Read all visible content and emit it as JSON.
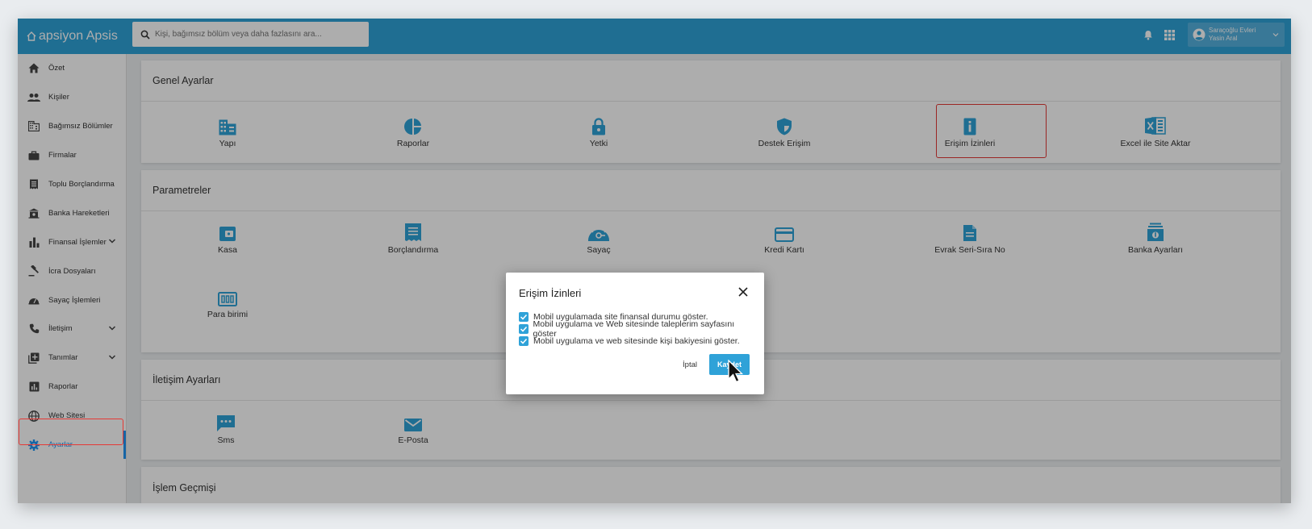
{
  "app": {
    "logo": "apsiyon Apsis"
  },
  "search": {
    "placeholder": "Kişi, bağımsız bölüm veya daha fazlasını ara..."
  },
  "user": {
    "site": "Saraçoğlu Evleri",
    "name": "Yasin Aral"
  },
  "sidebar": {
    "items": [
      {
        "label": "Özet"
      },
      {
        "label": "Kişiler"
      },
      {
        "label": "Bağımsız Bölümler"
      },
      {
        "label": "Firmalar"
      },
      {
        "label": "Toplu Borçlandırma"
      },
      {
        "label": "Banka Hareketleri"
      },
      {
        "label": "Finansal İşlemler"
      },
      {
        "label": "İcra Dosyaları"
      },
      {
        "label": "Sayaç İşlemleri"
      },
      {
        "label": "İletişim"
      },
      {
        "label": "Tanımlar"
      },
      {
        "label": "Raporlar"
      },
      {
        "label": "Web Sitesi"
      },
      {
        "label": "Ayarlar"
      }
    ]
  },
  "sections": {
    "general": {
      "title": "Genel Ayarlar",
      "tiles": [
        "Yapı",
        "Raporlar",
        "Yetki",
        "Destek Erişim",
        "Erişim İzinleri",
        "Excel ile Site Aktar"
      ]
    },
    "parameters": {
      "title": "Parametreler",
      "tiles": [
        "Kasa",
        "Borçlandırma",
        "Sayaç",
        "Kredi Kartı",
        "Evrak Seri-Sıra No",
        "Banka Ayarları",
        "Para birimi"
      ]
    },
    "communication": {
      "title": "İletişim Ayarları",
      "tiles": [
        "Sms",
        "E-Posta"
      ]
    },
    "history": {
      "title": "İşlem Geçmişi"
    }
  },
  "dialog": {
    "title": "Erişim İzinleri",
    "options": [
      "Mobil uygulamada site finansal durumu göster.",
      "Mobil uygulama ve Web sitesinde taleplerim sayfasını göster",
      "Mobil uygulama ve web sitesinde kişi bakiyesini göster."
    ],
    "cancel_label": "İptal",
    "save_label": "Kaydet"
  },
  "colors": {
    "brand": "#2fa2d8",
    "highlight": "#e53935",
    "active": "#2196f3"
  }
}
